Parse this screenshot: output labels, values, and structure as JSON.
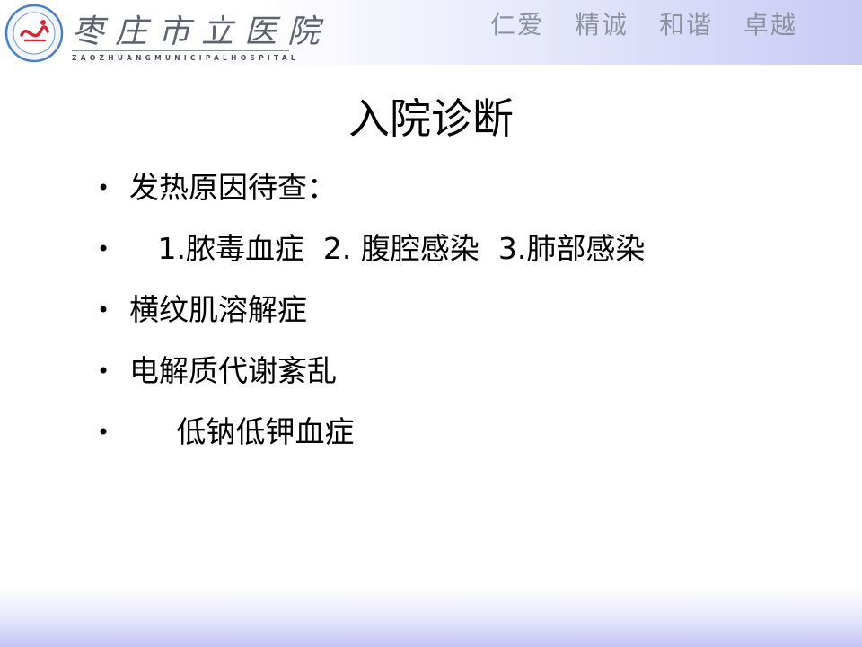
{
  "header": {
    "hospital_name_cn": "枣庄市立医院",
    "hospital_name_en": "ZAOZHUANGMUNICIPALHOSPITAL",
    "motto": [
      "仁爱",
      "精诚",
      "和谐",
      "卓越"
    ],
    "accent_color": "#c9caf5",
    "logo_color": "#d0283a"
  },
  "slide": {
    "title": "入院诊断",
    "bullets": [
      {
        "text": "发热原因待查："
      },
      {
        "text": "   1.脓毒血症  2. 腹腔感染  3.肺部感染"
      },
      {
        "text": "横纹肌溶解症"
      },
      {
        "text": "电解质代谢紊乱"
      },
      {
        "text": "     低钠低钾血症"
      }
    ],
    "bullet_symbol": "•"
  }
}
